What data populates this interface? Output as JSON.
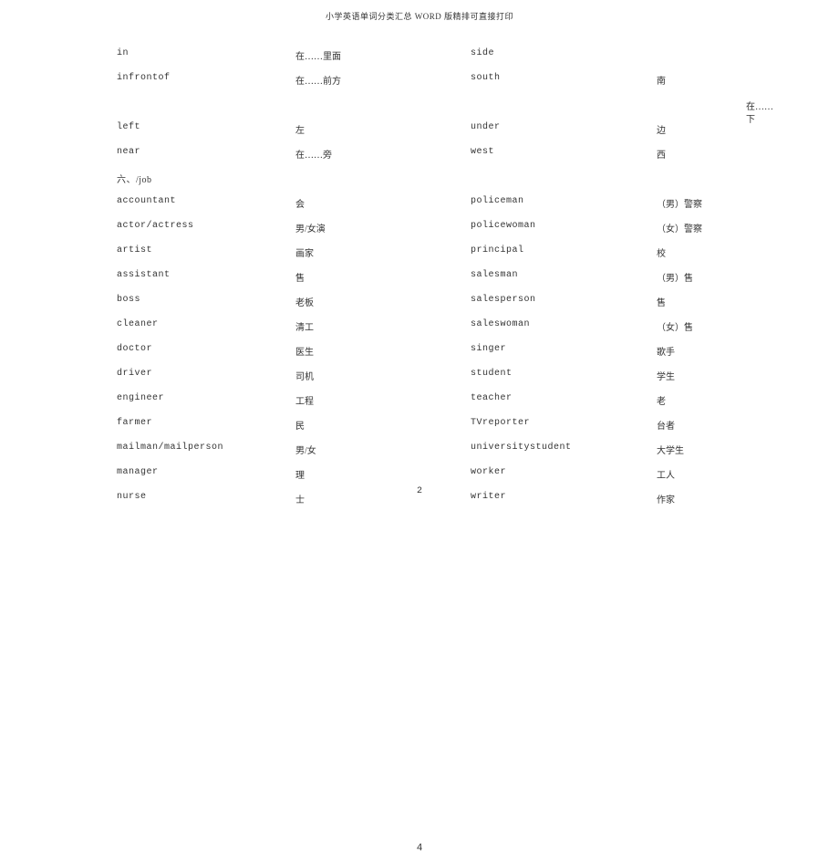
{
  "header": "小学英语单词分类汇总 WORD 版精排可直接打印",
  "rows": [
    {
      "c1": "in",
      "c2": "在……里面",
      "c3": "side",
      "c4": ""
    },
    {
      "c1": "infrontof",
      "c2": "在……前方",
      "c3": "south",
      "c4": "南"
    },
    {
      "c1": "",
      "c2": "",
      "c3": "",
      "c4": ""
    },
    {
      "c1": "left",
      "c2": "左",
      "c3": "under",
      "c4": "边"
    },
    {
      "c1": "near",
      "c2": "在……旁",
      "c3": "west",
      "c4": "西"
    },
    {
      "c1": "六、/job",
      "c2": "",
      "c3": "",
      "c4": "",
      "section": true
    },
    {
      "c1": "accountant",
      "c2": "会",
      "c3": "policeman",
      "c4": "（男）警察"
    },
    {
      "c1": "actor/actress",
      "c2": "男/女演",
      "c3": "policewoman",
      "c4": "（女）警察"
    },
    {
      "c1": "artist",
      "c2": "画家",
      "c3": "principal",
      "c4": "校"
    },
    {
      "c1": "assistant",
      "c2": "售",
      "c3": "salesman",
      "c4": "（男）售"
    },
    {
      "c1": "boss",
      "c2": "老板",
      "c3": "salesperson",
      "c4": "售"
    },
    {
      "c1": "cleaner",
      "c2": "清工",
      "c3": "saleswoman",
      "c4": "（女）售"
    },
    {
      "c1": "doctor",
      "c2": "医生",
      "c3": "singer",
      "c4": "歌手"
    },
    {
      "c1": "driver",
      "c2": "司机",
      "c3": "student",
      "c4": "学生"
    },
    {
      "c1": "engineer",
      "c2": "工程",
      "c3": "teacher",
      "c4": "老"
    },
    {
      "c1": "farmer",
      "c2": "民",
      "c3": "TVreporter",
      "c4": "台者"
    },
    {
      "c1": "mailman/mailperson",
      "c2": "男/女",
      "c3": "universitystudent",
      "c4": "大学生"
    },
    {
      "c1": "manager",
      "c2": "理",
      "c3": "worker",
      "c4": "工人"
    },
    {
      "c1": "nurse",
      "c2": "士",
      "c3": "writer",
      "c4": "作家"
    }
  ],
  "under_text_line1": "在……下",
  "page2": "2",
  "page4": "4"
}
